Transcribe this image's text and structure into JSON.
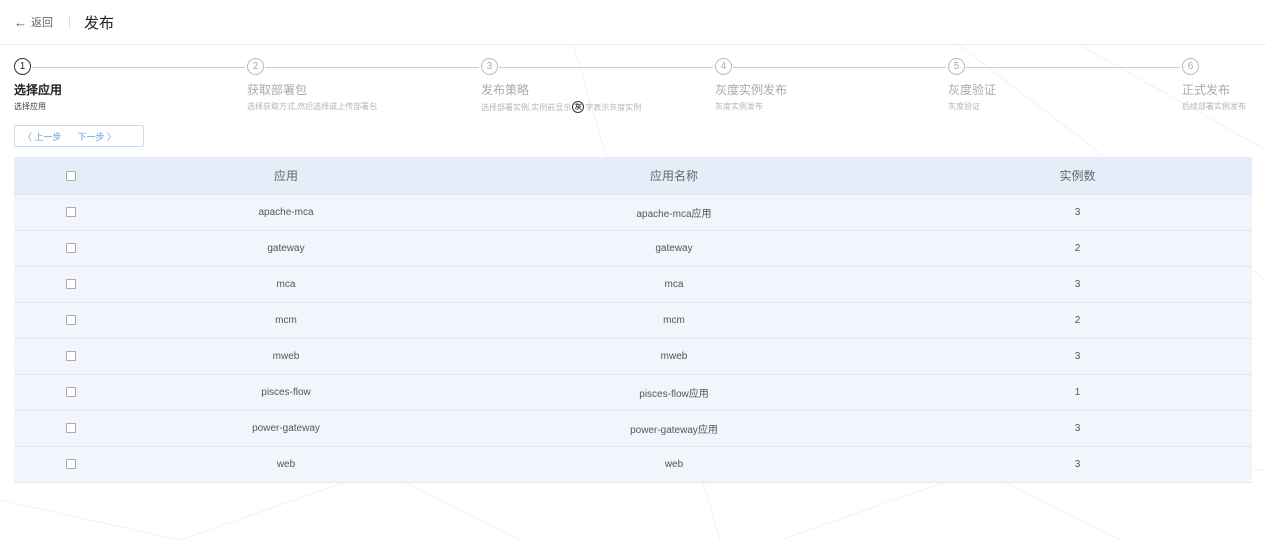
{
  "header": {
    "back_label": "返回",
    "title": "发布"
  },
  "steps": [
    {
      "number": "1",
      "label": "选择应用",
      "desc": "选择应用",
      "active": true
    },
    {
      "number": "2",
      "label": "获取部署包",
      "desc": "选择获取方式,然后选择或上传部署包",
      "active": false
    },
    {
      "number": "3",
      "label": "发布策略",
      "desc_before": "选择部署实例,实例前显示",
      "badge": "灰",
      "desc_after": "字表示灰度实例",
      "active": false
    },
    {
      "number": "4",
      "label": "灰度实例发布",
      "desc": "灰度实例发布",
      "active": false
    },
    {
      "number": "5",
      "label": "灰度验证",
      "desc": "灰度验证",
      "active": false
    },
    {
      "number": "6",
      "label": "正式发布",
      "desc": "后续部署实例发布",
      "active": false
    }
  ],
  "pager": {
    "prev_label": "〈 上一步",
    "next_label": "下一步 〉"
  },
  "table": {
    "columns": [
      "应用",
      "应用名称",
      "实例数"
    ],
    "rows": [
      {
        "app": "apache-mca",
        "name": "apache-mca应用",
        "count": "3"
      },
      {
        "app": "gateway",
        "name": "gateway",
        "count": "2"
      },
      {
        "app": "mca",
        "name": "mca",
        "count": "3"
      },
      {
        "app": "mcm",
        "name": "mcm",
        "count": "2"
      },
      {
        "app": "mweb",
        "name": "mweb",
        "count": "3"
      },
      {
        "app": "pisces-flow",
        "name": "pisces-flow应用",
        "count": "1"
      },
      {
        "app": "power-gateway",
        "name": "power-gateway应用",
        "count": "3"
      },
      {
        "app": "web",
        "name": "web",
        "count": "3"
      }
    ]
  }
}
